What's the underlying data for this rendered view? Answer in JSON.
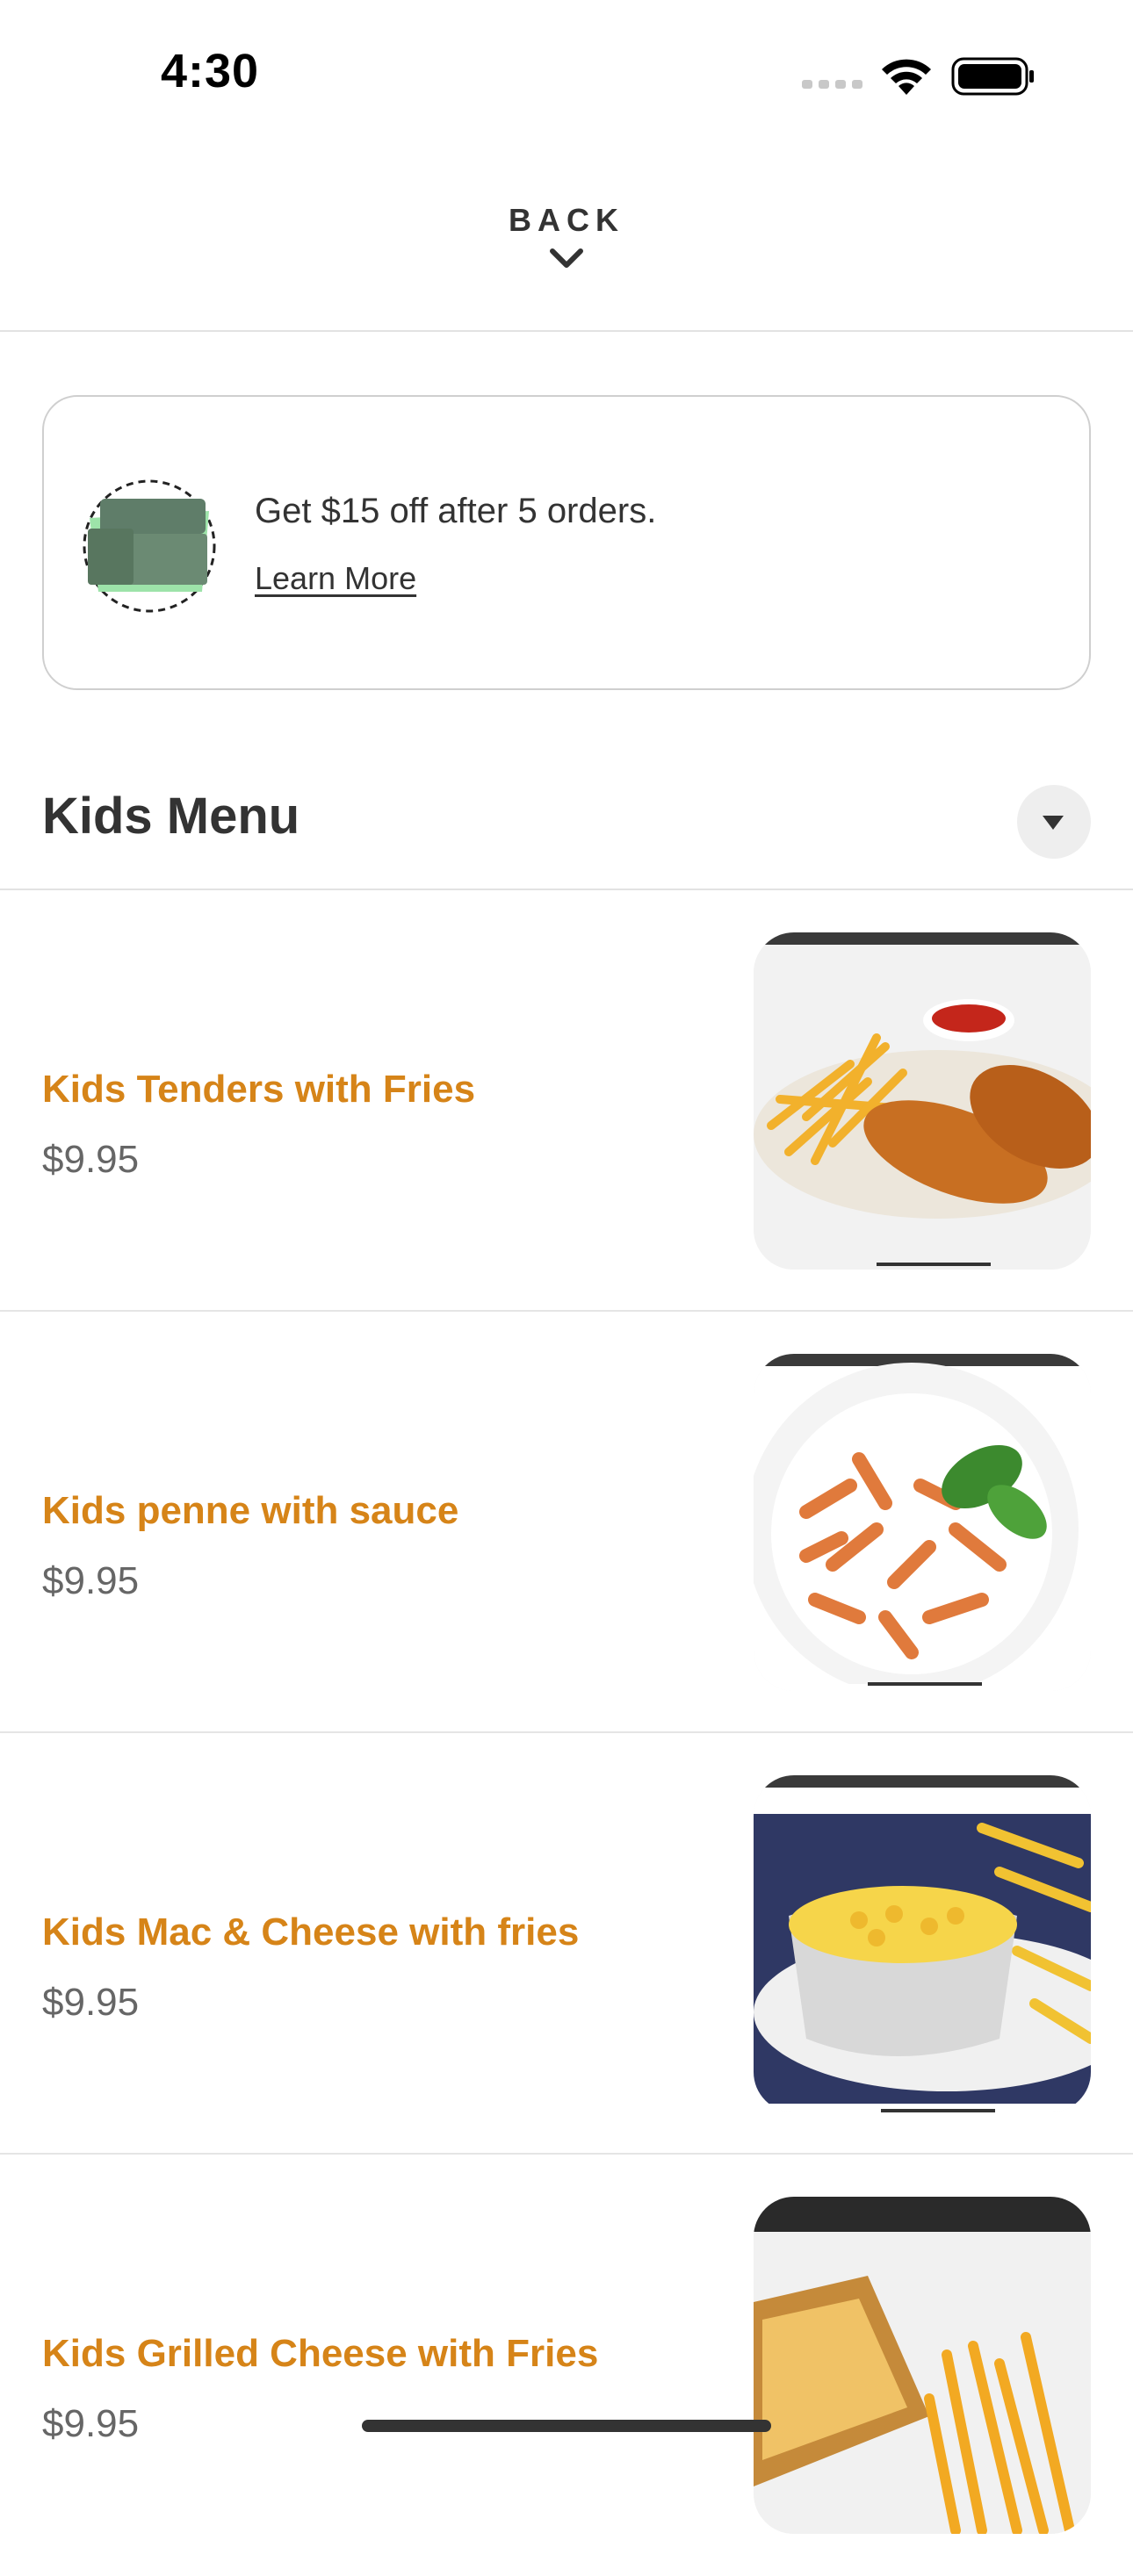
{
  "status_bar": {
    "time": "4:30",
    "icons": [
      "signal-icon",
      "wifi-icon",
      "battery-icon"
    ]
  },
  "header": {
    "back_label": "BACK",
    "back_icon": "chevron-down-icon"
  },
  "promo": {
    "icon": "bag-icon",
    "text": "Get $15 off after 5 orders.",
    "link_label": "Learn More"
  },
  "section": {
    "title": "Kids Menu",
    "toggle_icon": "caret-down-icon"
  },
  "menu_items": [
    {
      "name": "Kids Tenders with Fries",
      "price": "$9.95",
      "image_icon": "chicken-tenders-image"
    },
    {
      "name": "Kids penne with sauce",
      "price": "$9.95",
      "image_icon": "penne-pasta-image"
    },
    {
      "name": "Kids Mac & Cheese with fries",
      "price": "$9.95",
      "image_icon": "mac-and-cheese-image"
    },
    {
      "name": "Kids Grilled Cheese with Fries",
      "price": "$9.95",
      "image_icon": "grilled-cheese-image"
    }
  ],
  "colors": {
    "accent": "#d68418",
    "text": "#333333",
    "price": "#666666",
    "divider": "#e2e2e2"
  }
}
